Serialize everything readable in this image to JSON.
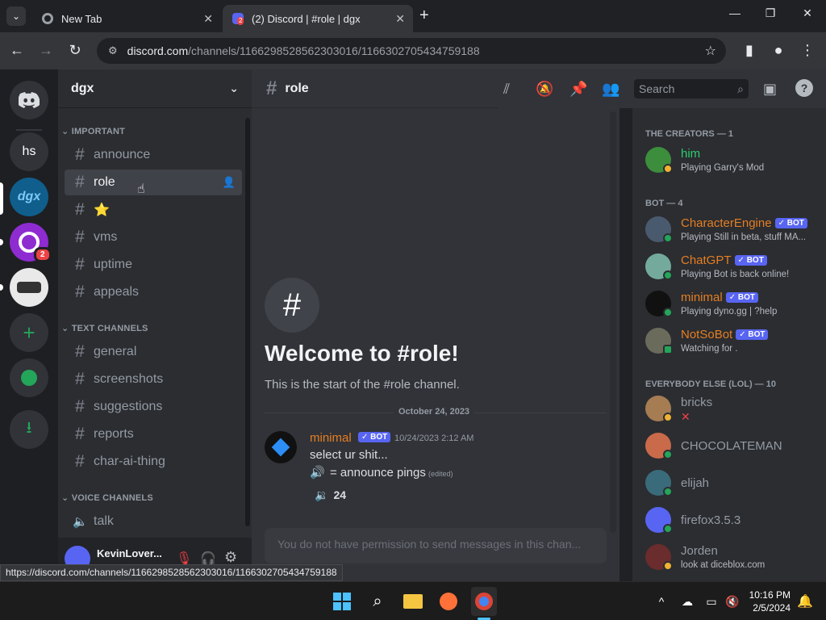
{
  "browser": {
    "tabs": [
      {
        "title": "New Tab"
      },
      {
        "title": "(2) Discord | #role | dgx",
        "badge": "2"
      }
    ],
    "url_domain": "discord.com",
    "url_path": "/channels/1166298528562303016/1166302705434759188",
    "status_url": "https://discord.com/channels/1166298528562303016/1166302705434759188"
  },
  "servers": [
    {
      "label": "hs"
    },
    {
      "label": "dgx"
    },
    {
      "label": "",
      "badge": "2"
    }
  ],
  "guild": {
    "name": "dgx"
  },
  "categories": {
    "important": "IMPORTANT",
    "text": "TEXT CHANNELS",
    "voice": "VOICE CHANNELS"
  },
  "channels_important": [
    "announce",
    "role",
    "⭐",
    "vms",
    "uptime",
    "appeals"
  ],
  "channels_text": [
    "general",
    "screenshots",
    "suggestions",
    "reports",
    "char-ai-thing"
  ],
  "channels_voice": [
    "talk"
  ],
  "user": {
    "name": "KevinLover..."
  },
  "channel": {
    "name": "role",
    "welcome_title": "Welcome to #role!",
    "welcome_sub": "This is the start of the #role channel.",
    "date_divider": "October 24, 2023",
    "composer_placeholder": "You do not have permission to send messages in this chan..."
  },
  "header": {
    "search_placeholder": "Search"
  },
  "message": {
    "author": "minimal",
    "bot_tag": "BOT",
    "timestamp": "10/24/2023 2:12 AM",
    "line1": "select ur shit...",
    "line2": "= announce pings",
    "edited": "(edited)",
    "reaction_count": "24"
  },
  "members": {
    "cat1": "THE CREATORS — 1",
    "cat2": "BOT — 4",
    "cat3": "EVERYBODY ELSE (LOL) — 10",
    "creators": [
      {
        "name": "him",
        "sub": "Playing Garry's Mod",
        "color": "#2ecc71"
      }
    ],
    "bots": [
      {
        "name": "CharacterEngine",
        "sub": "Playing Still in beta, stuff MA...",
        "color": "#e67e22"
      },
      {
        "name": "ChatGPT",
        "sub": "Playing Bot is back online!",
        "color": "#e67e22"
      },
      {
        "name": "minimal",
        "sub": "Playing dyno.gg | ?help",
        "color": "#e67e22"
      },
      {
        "name": "NotSoBot",
        "sub": "Watching for .",
        "color": "#e67e22"
      }
    ],
    "others": [
      {
        "name": "bricks",
        "sub": "",
        "color": "#949ba4"
      },
      {
        "name": "CHOCOLATEMAN",
        "sub": "",
        "color": "#949ba4"
      },
      {
        "name": "elijah",
        "sub": "",
        "color": "#949ba4"
      },
      {
        "name": "firefox3.5.3",
        "sub": "",
        "color": "#949ba4"
      },
      {
        "name": "Jorden",
        "sub": "look at diceblox.com",
        "color": "#949ba4"
      }
    ]
  },
  "taskbar": {
    "time": "10:16 PM",
    "date": "2/5/2024"
  }
}
